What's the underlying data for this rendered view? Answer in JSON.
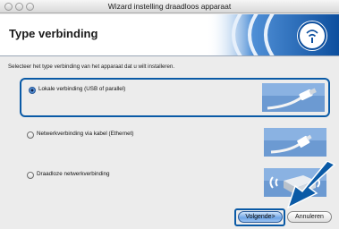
{
  "window": {
    "title": "Wizard instelling draadloos apparaat"
  },
  "header": {
    "title": "Type verbinding"
  },
  "instruction": "Selecteer het type verbinding van het apparaat dat u wilt installeren.",
  "options": [
    {
      "label": "Lokale verbinding (USB of parallel)",
      "selected": true,
      "icon": "usb-cable-icon"
    },
    {
      "label": "Netwerkverbinding via kabel (Ethernet)",
      "selected": false,
      "icon": "ethernet-cable-icon"
    },
    {
      "label": "Draadloze netwerkverbinding",
      "selected": false,
      "icon": "wireless-printer-icon"
    }
  ],
  "buttons": {
    "next": "Volgende>",
    "cancel": "Annuleren"
  },
  "colors": {
    "highlight": "#0a5aa6",
    "header_art": "#1660b3"
  }
}
